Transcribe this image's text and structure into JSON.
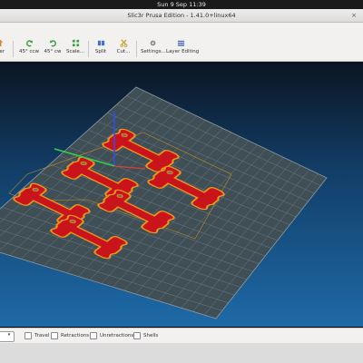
{
  "system": {
    "clock": "Sun 9 Sep  11:39"
  },
  "window": {
    "title": "Slic3r Prusa Edition - 1.41.0+linux64",
    "close_glyph": "×"
  },
  "toolbar": {
    "items": [
      {
        "label": "wer",
        "icon": "arrows-icon"
      },
      {
        "label": "45° ccw",
        "icon": "rotate-ccw-icon"
      },
      {
        "label": "45° cw",
        "icon": "rotate-cw-icon"
      },
      {
        "label": "Scale...",
        "icon": "scale-icon"
      },
      {
        "label": "Split",
        "icon": "split-icon"
      },
      {
        "label": "Cut...",
        "icon": "cut-icon"
      },
      {
        "label": "Settings...",
        "icon": "gear-icon"
      },
      {
        "label": "Layer Editing",
        "icon": "layers-icon"
      }
    ]
  },
  "viewport": {
    "bed_color": "#3f4f55",
    "grid_color": "#77868c",
    "part_fill": "#c8141a",
    "part_outline": "#e8961e",
    "skirt_color": "#e8961e",
    "axes": {
      "x": "#e23b3b",
      "y": "#2fd24a",
      "z": "#2a4fff"
    }
  },
  "bottombar": {
    "select_arrow": "▾",
    "checkboxes": [
      {
        "label": "Travel",
        "checked": false
      },
      {
        "label": "Retractions",
        "checked": false
      },
      {
        "label": "Unretractions",
        "checked": false
      },
      {
        "label": "Shells",
        "checked": false
      }
    ]
  }
}
